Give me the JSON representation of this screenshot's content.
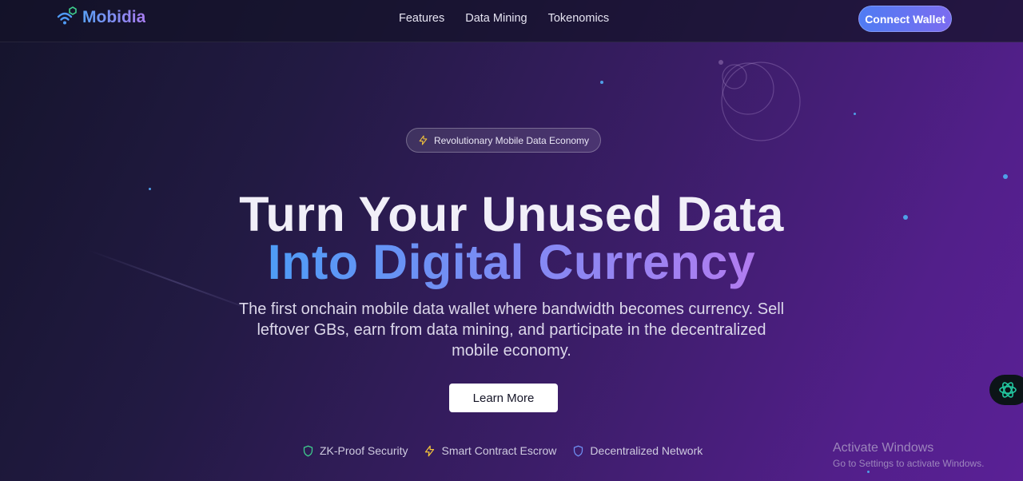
{
  "nav": {
    "logo_text": "Mobidia",
    "logo_icon": "wifi-hexagon-icon",
    "links": [
      "Features",
      "Data Mining",
      "Tokenomics"
    ],
    "connect_label": "Connect Wallet"
  },
  "hero": {
    "badge_icon": "lightning-icon",
    "badge_text": "Revolutionary Mobile Data Economy",
    "title_line1": "Turn Your Unused Data",
    "title_line2": "Into Digital Currency",
    "subtitle": "The first onchain mobile data wallet where bandwidth becomes currency. Sell leftover GBs, earn from data mining, and participate in the decentralized mobile economy.",
    "cta_label": "Learn More",
    "features": [
      {
        "icon": "shield-icon",
        "label": "ZK-Proof Security"
      },
      {
        "icon": "lightning-icon",
        "label": "Smart Contract Escrow"
      },
      {
        "icon": "shield-icon",
        "label": "Decentralized Network"
      }
    ]
  },
  "chat_widget_icon": "chatgpt-icon",
  "watermark": {
    "title": "Activate Windows",
    "subtitle": "Go to Settings to activate Windows."
  },
  "colors": {
    "accent_blue": "#4f7cf3",
    "accent_purple": "#a77cf0",
    "feature_green": "#3ecf8e",
    "feature_yellow": "#f2c23a",
    "feature_blue": "#6f8ff2"
  }
}
